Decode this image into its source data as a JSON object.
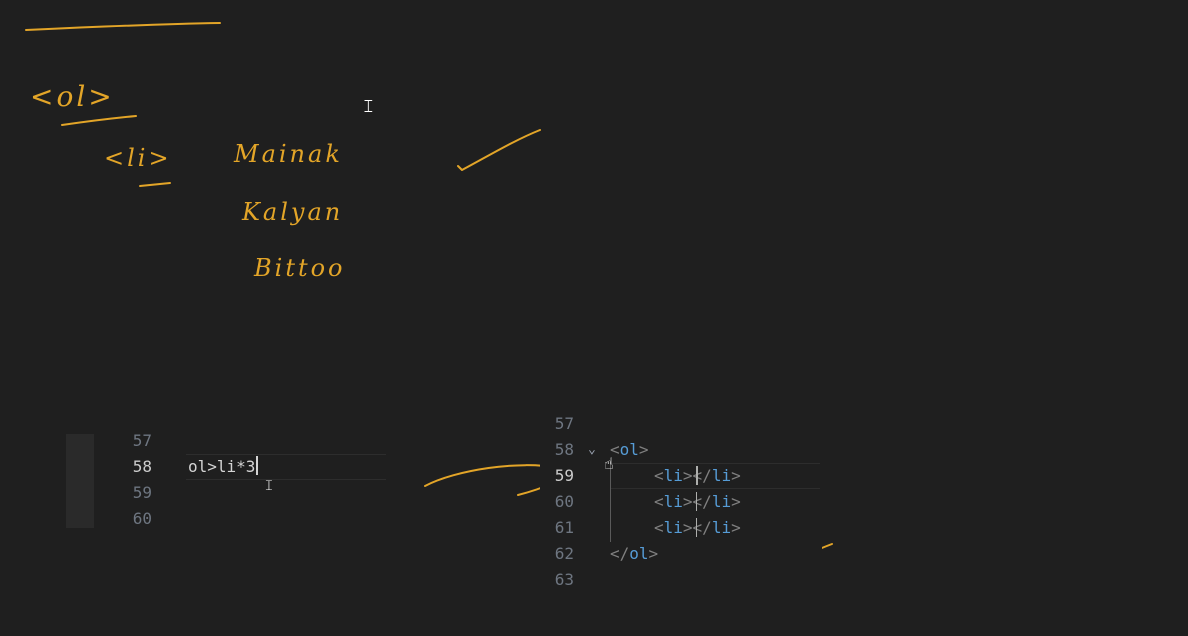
{
  "sketch": {
    "open_tag": "<ol>",
    "item_tag": "<li>",
    "names": [
      "Mainak",
      "Kalyan",
      "Bittoo"
    ]
  },
  "left_editor": {
    "lines": [
      {
        "number": "57",
        "code": ""
      },
      {
        "number": "58",
        "code": "ol>li*3"
      },
      {
        "number": "59",
        "code": ""
      },
      {
        "number": "60",
        "code": ""
      }
    ],
    "active_line": "58"
  },
  "right_editor": {
    "line_numbers": [
      "57",
      "58",
      "59",
      "60",
      "61",
      "62",
      "63"
    ],
    "active_line": "59",
    "code": {
      "open_ol_lt": "<",
      "open_ol_name": "ol",
      "open_ol_gt": ">",
      "li_open_lt": "<",
      "li_open_name": "li",
      "li_open_gt": ">",
      "li_close_lt": "</",
      "li_close_name": "li",
      "li_close_gt": ">",
      "close_ol_lt": "</",
      "close_ol_name": "ol",
      "close_ol_gt": ">"
    },
    "fold_icon": "chevron-down-icon"
  },
  "colors": {
    "background": "#1f1f1f",
    "ink": "#e3a528",
    "tag_name": "#569cd6",
    "tag_bracket": "#808080",
    "line_number": "#6e7681"
  }
}
